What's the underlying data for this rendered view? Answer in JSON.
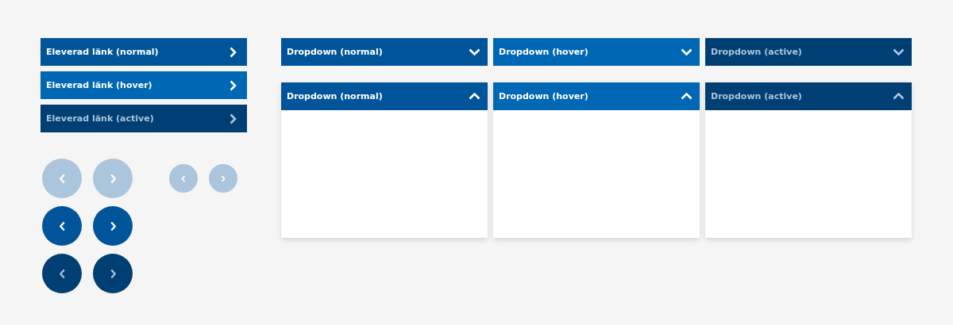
{
  "links": [
    {
      "label": "Eleverad länk (normal)",
      "hover": false,
      "active": false
    },
    {
      "label": "Eleverad länk (hover)",
      "hover": true,
      "active": false
    },
    {
      "label": "Eleverad länk (active)",
      "hover": false,
      "active": true
    }
  ],
  "nav_rows": [
    {
      "disabled": true,
      "active": false,
      "buttons": [
        {
          "kind": "prev"
        },
        {
          "kind": "next"
        }
      ],
      "small_buttons": [
        {
          "kind": "prev"
        },
        {
          "kind": "next"
        }
      ]
    },
    {
      "disabled": false,
      "active": false,
      "buttons": [
        {
          "kind": "prev"
        },
        {
          "kind": "next"
        }
      ]
    },
    {
      "disabled": false,
      "active": true,
      "buttons": [
        {
          "kind": "prev"
        },
        {
          "kind": "next"
        }
      ]
    }
  ],
  "dropdown_rows": [
    {
      "expanded": false,
      "dropdowns": [
        {
          "label": "Dropdown (normal)",
          "hover": false,
          "active": false
        },
        {
          "label": "Dropdown (hover)",
          "hover": true,
          "active": false
        },
        {
          "label": "Dropdown (active)",
          "hover": false,
          "active": true
        }
      ]
    },
    {
      "expanded": true,
      "dropdowns": [
        {
          "label": "Dropdown (normal)",
          "hover": false,
          "active": false
        },
        {
          "label": "Dropdown (hover)",
          "hover": true,
          "active": false
        },
        {
          "label": "Dropdown (active)",
          "hover": false,
          "active": true
        }
      ]
    }
  ]
}
